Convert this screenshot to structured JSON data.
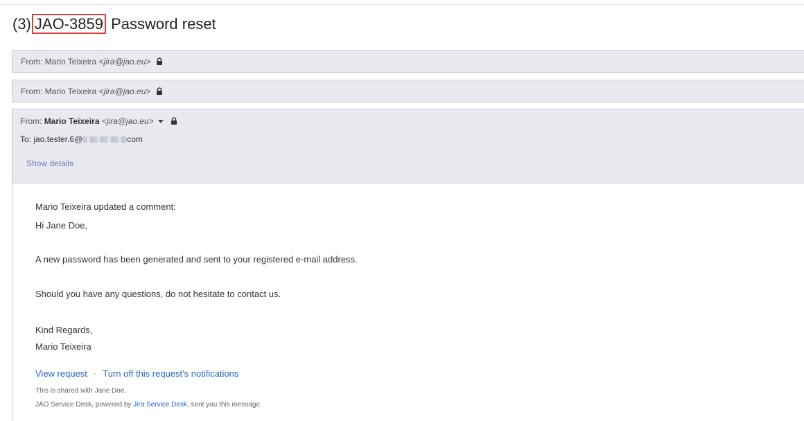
{
  "thread": {
    "count_prefix": "(3)",
    "ticket_id": "JAO-3859",
    "subject": "Password reset"
  },
  "collapsed_messages": [
    {
      "from_label": "From:",
      "sender_name": "Mario Teixeira",
      "sender_email": "<jira@jao.eu>"
    },
    {
      "from_label": "From:",
      "sender_name": "Mario Teixeira",
      "sender_email": "<jira@jao.eu>"
    }
  ],
  "open_message": {
    "from_label": "From:",
    "sender_name": "Mario Teixeira",
    "sender_email": "<jira@jao.eu>",
    "to_label": "To:",
    "to_local": "jao.tester.6@",
    "to_suffix": "com",
    "show_details": "Show details"
  },
  "body": {
    "intro": "Mario Teixeira updated a comment:",
    "greeting": "Hi Jane Doe,",
    "para1": "A new password has been generated and sent to your registered e-mail address.",
    "para2": "Should you have any questions, do not hesitate to contact us.",
    "closing": "Kind Regards,",
    "signature": "Mario Teixeira"
  },
  "footer": {
    "view_request": "View request",
    "separator": "·",
    "turn_off": "Turn off this request's notifications",
    "shared_with": "This is shared with Jane Doe.",
    "powered_prefix": "JAO Service Desk, powered by ",
    "powered_link": "Jira Service Desk",
    "powered_suffix": ", sent you this message."
  },
  "colors": {
    "header_bg": "#e8eaf0",
    "link": "#2166c4",
    "highlight_border": "#e03a3a"
  }
}
